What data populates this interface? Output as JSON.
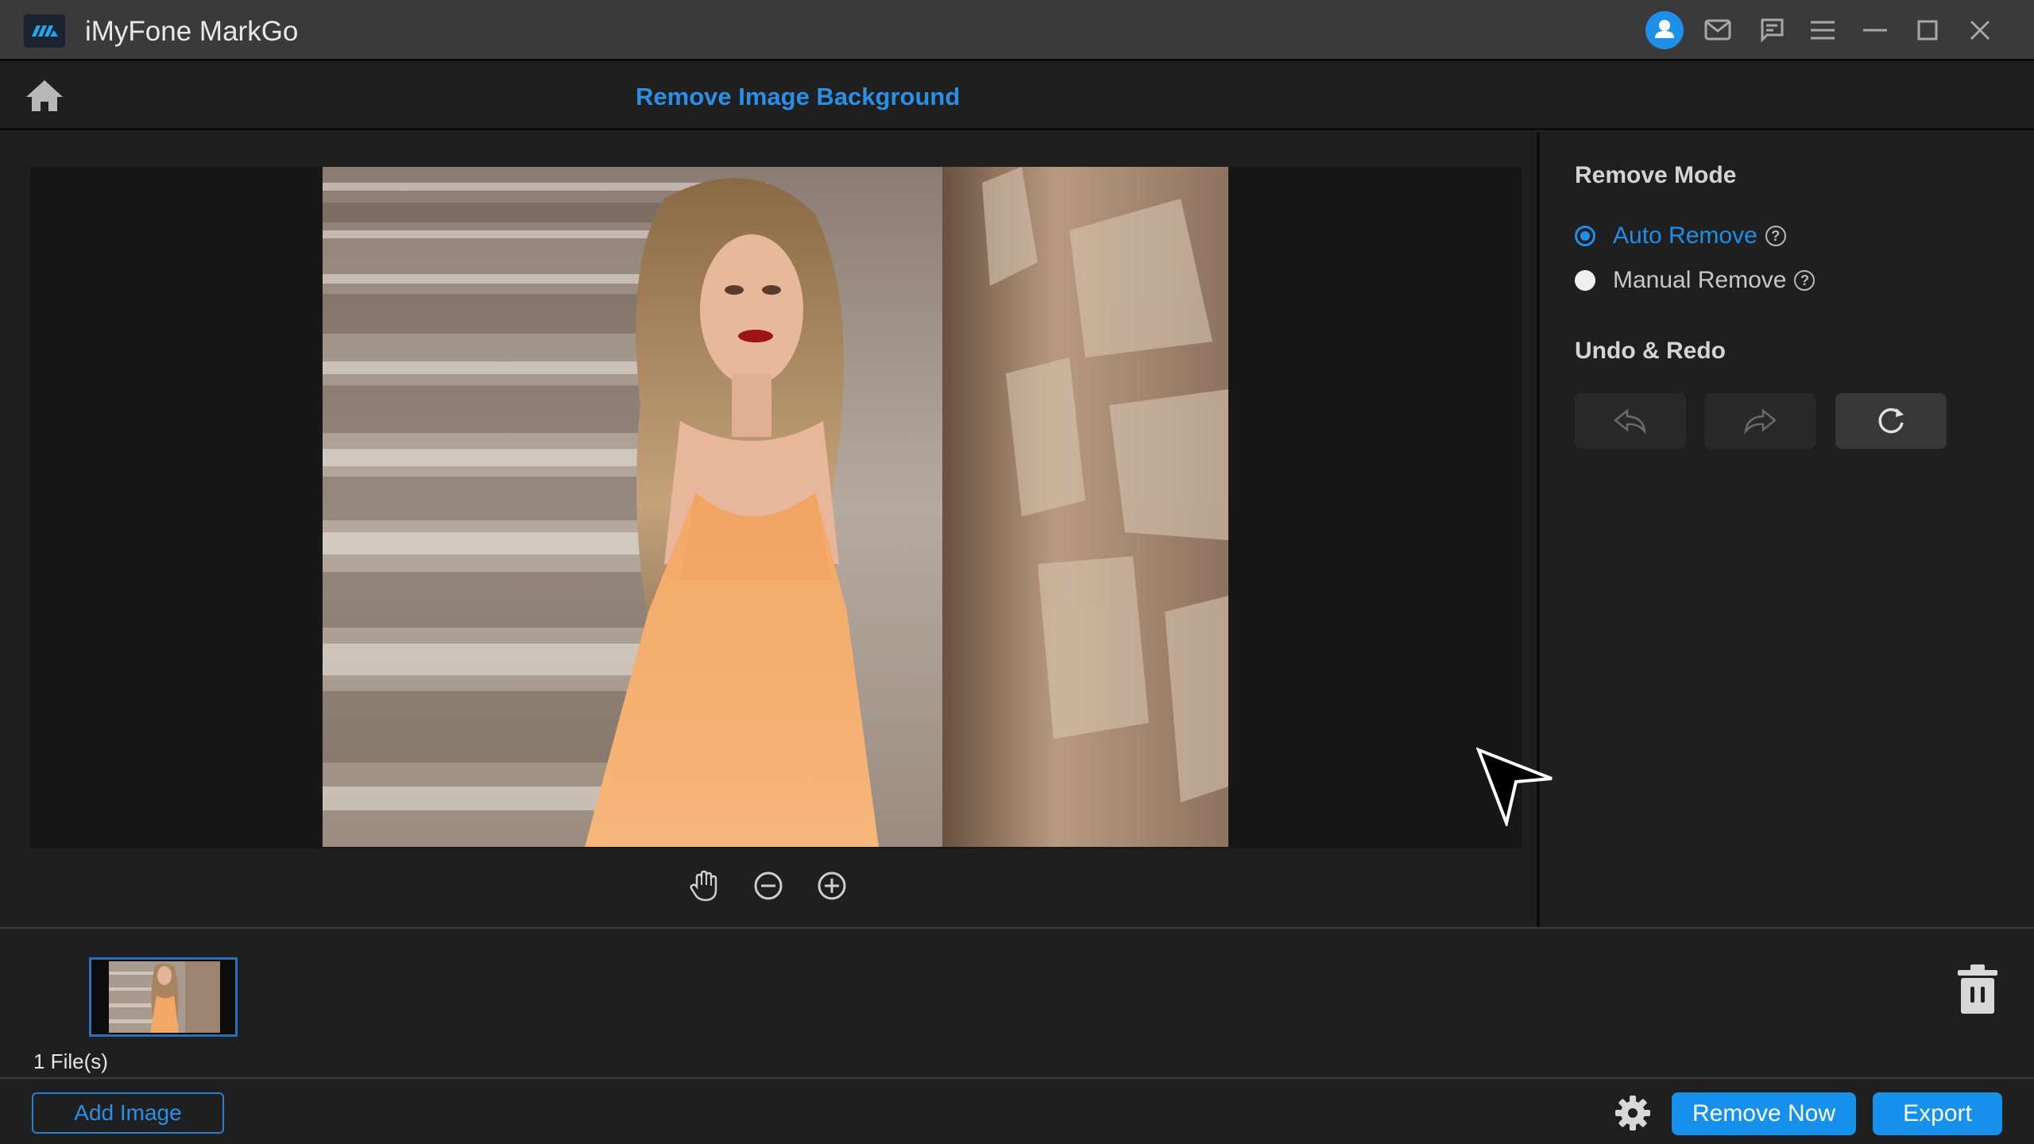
{
  "window": {
    "app_title": "iMyFone MarkGo",
    "titlebar_icons": [
      "account-icon",
      "mail-icon",
      "feedback-icon",
      "menu-icon",
      "minimize-icon",
      "maximize-icon",
      "close-icon"
    ]
  },
  "header": {
    "home_icon": "home-icon",
    "page_title": "Remove Image Background"
  },
  "workspace": {
    "image_description": "Woman in orange dress leaning against a stone wall beside outdoor stairs",
    "tools": [
      "hand-pan-icon",
      "zoom-out-icon",
      "zoom-in-icon"
    ]
  },
  "right_panel": {
    "remove_mode": {
      "title": "Remove Mode",
      "options": [
        {
          "label": "Auto Remove",
          "selected": true,
          "help": "?"
        },
        {
          "label": "Manual Remove",
          "selected": false,
          "help": "?"
        }
      ]
    },
    "undo_redo": {
      "title": "Undo & Redo",
      "buttons": [
        {
          "name": "undo",
          "icon": "undo-icon",
          "enabled": false
        },
        {
          "name": "redo",
          "icon": "redo-icon",
          "enabled": false
        },
        {
          "name": "reset",
          "icon": "reset-icon",
          "enabled": true
        }
      ]
    }
  },
  "file_strip": {
    "file_count": "1 File(s)",
    "delete_icon": "trash-icon"
  },
  "bottom_bar": {
    "add_image_label": "Add Image",
    "settings_icon": "gear-icon",
    "remove_now_label": "Remove Now",
    "export_label": "Export"
  },
  "colors": {
    "accent": "#1591ec",
    "title_accent": "#2a8fe6",
    "titlebar_bg": "#3a3a3a",
    "app_bg": "#1f1f1f",
    "canvas_bg": "#171717"
  }
}
